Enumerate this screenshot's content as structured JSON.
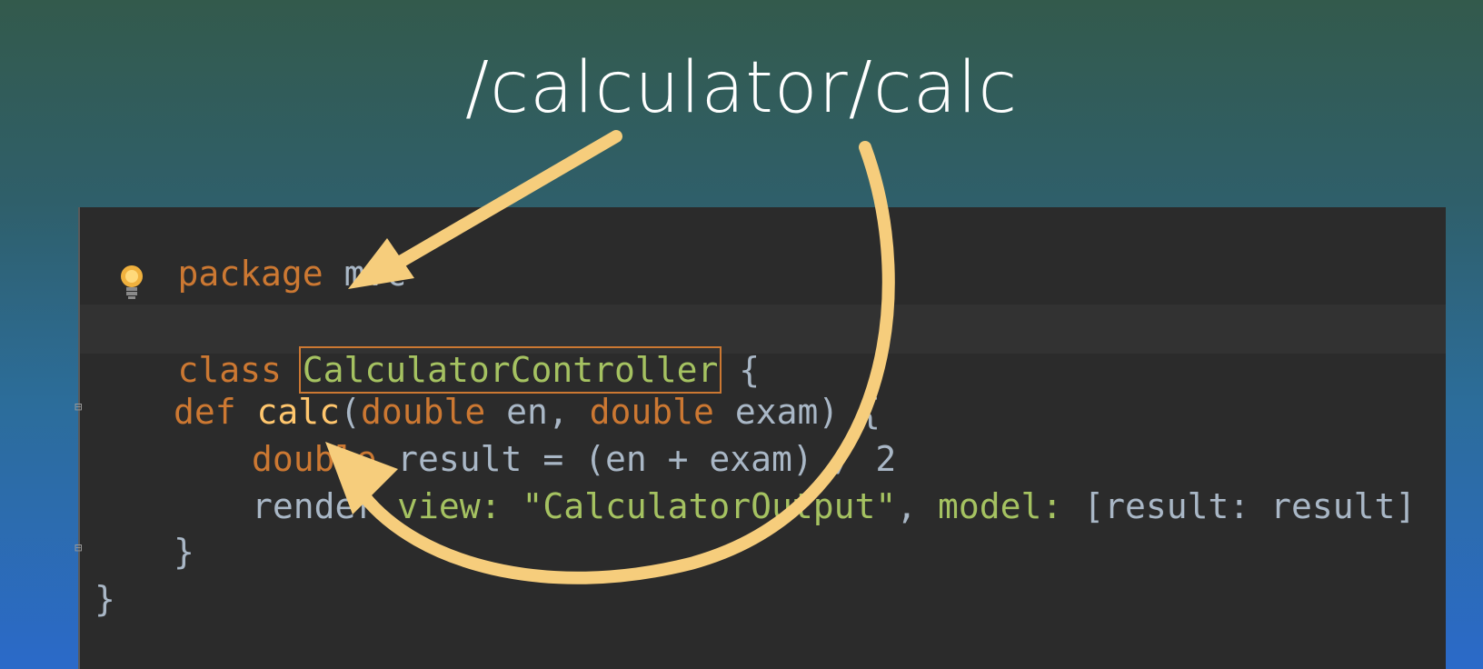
{
  "slide": {
    "title": "/calculator/calc"
  },
  "code": {
    "line1": {
      "kw": "package",
      "name": "mvc"
    },
    "line2": {
      "kw": "class",
      "name": "CalculatorController",
      "brace": "{"
    },
    "line3": {
      "kw": "def",
      "fn": "calc",
      "p1": "(",
      "t1": "double",
      "a1": "en",
      "comma": ",",
      "t2": "double",
      "a2": "exam",
      "rest": ") {"
    },
    "line4": {
      "kw": "double",
      "rest": "result = (en + exam) / 2"
    },
    "line5": {
      "render": "render ",
      "view_key": "view:",
      "view_val": "\"CalculatorOutput\"",
      "comma": ",",
      "model_key": "model:",
      "model_val": "[result: result]"
    },
    "line6": {
      "brace": "}"
    },
    "line7": {
      "brace": "}"
    }
  },
  "colors": {
    "arrow": "#f6cd7c",
    "keyword": "#cc7832",
    "class_name": "#a5c261",
    "background": "#2b2b2b"
  },
  "icons": [
    "lightbulb-icon",
    "fold-marker-icon"
  ]
}
